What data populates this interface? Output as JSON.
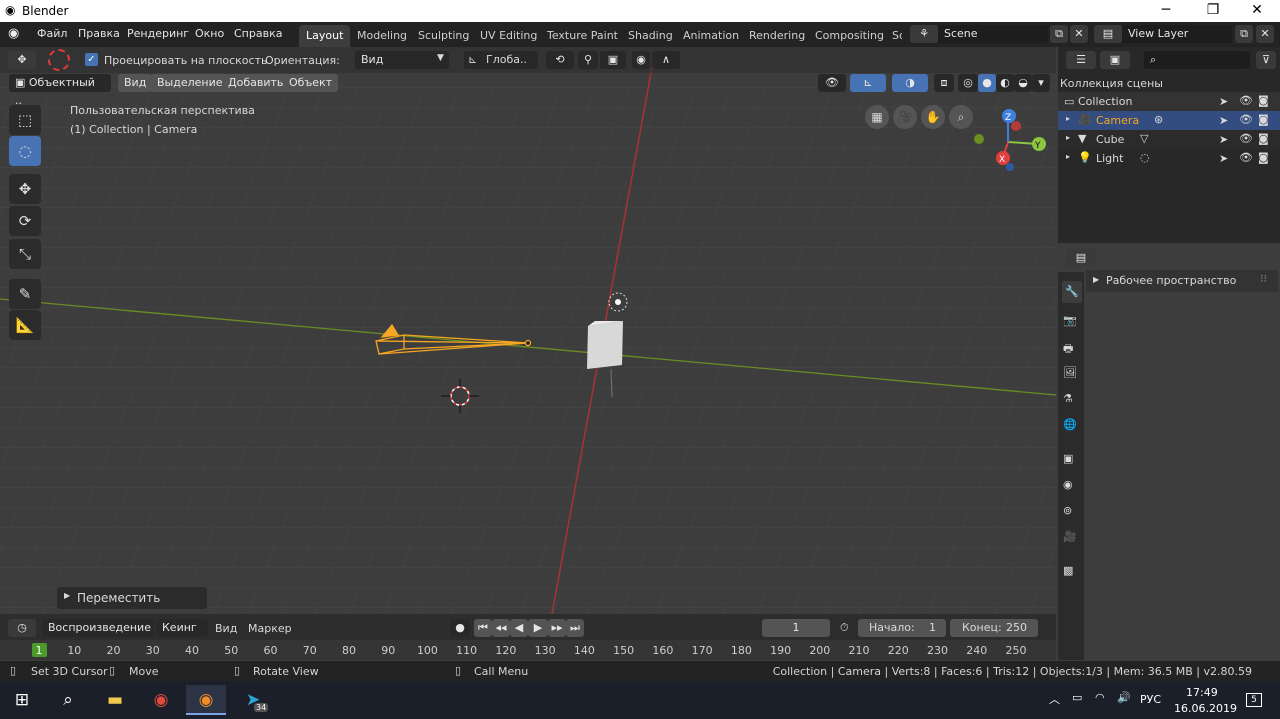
{
  "window": {
    "title": "Blender"
  },
  "menu": [
    "Файл",
    "Правка",
    "Рендеринг",
    "Окно",
    "Справка"
  ],
  "workspace_tabs": [
    "Layout",
    "Modeling",
    "Sculpting",
    "UV Editing",
    "Texture Paint",
    "Shading",
    "Animation",
    "Rendering",
    "Compositing",
    "Sc"
  ],
  "scene": {
    "label": "Scene",
    "view_layer": "View Layer"
  },
  "tool_header": {
    "project_checkbox_label": "Проецировать на плоскость",
    "orientation_label": "Ориентация:",
    "orientation_value": "Вид",
    "global_value": "Глоба.."
  },
  "viewport_header": {
    "mode": "Объектный ..",
    "view": "Вид",
    "select": "Выделение",
    "add": "Добавить",
    "object": "Объект"
  },
  "viewport": {
    "perspective_label": "Пользовательская перспектива",
    "collection_label": "(1) Collection | Camera",
    "operator_panel": "Переместить"
  },
  "outliner": {
    "title": "Коллекция сцены",
    "rows": [
      {
        "name": "Collection"
      },
      {
        "name": "Camera"
      },
      {
        "name": "Cube"
      },
      {
        "name": "Light"
      }
    ]
  },
  "properties": {
    "panel": "Рабочее пространство"
  },
  "timeline": {
    "playback": "Воспроизведение",
    "keying": "Кеинг",
    "view": "Вид",
    "marker": "Маркер",
    "current_frame": "1",
    "start_label": "Начало:",
    "start_value": "1",
    "end_label": "Конец:",
    "end_value": "250",
    "ticks": [
      "1",
      "10",
      "20",
      "30",
      "40",
      "50",
      "60",
      "70",
      "80",
      "90",
      "100",
      "110",
      "120",
      "130",
      "140",
      "150",
      "160",
      "170",
      "180",
      "190",
      "200",
      "210",
      "220",
      "230",
      "240",
      "250"
    ]
  },
  "statusbar": {
    "set_cursor": "Set 3D Cursor",
    "move": "Move",
    "rotate": "Rotate View",
    "call_menu": "Call Menu",
    "stats": "Collection | Camera | Verts:8 | Faces:6 | Tris:12 | Objects:1/3 | Mem: 36.5 MB | v2.80.59"
  },
  "taskbar": {
    "lang": "РУС",
    "time": "17:49",
    "date": "16.06.2019",
    "telegram_badge": "34",
    "notif_count": "5"
  },
  "colors": {
    "accent": "#4772b3",
    "selected": "#f5a623",
    "x_axis": "#a83232",
    "y_axis": "#6a8e23"
  }
}
